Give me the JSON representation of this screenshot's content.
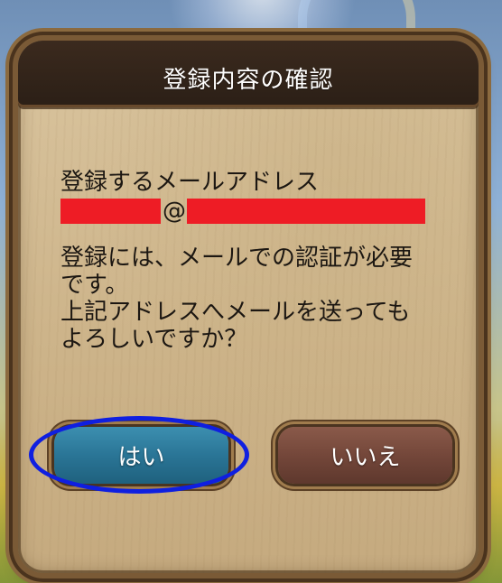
{
  "dialog": {
    "title": "登録内容の確認",
    "email_label": "登録するメールアドレス",
    "email_at": "@",
    "message_lines": [
      "登録には、メールでの認証が必要",
      "です。",
      "上記アドレスへメールを送っても",
      "よろしいですか？"
    ],
    "redaction_color": "#ee1c25"
  },
  "buttons": {
    "yes_label": "はい",
    "no_label": "いいえ",
    "yes_color": "#2a7596",
    "no_color": "#74473a"
  },
  "annotation": {
    "highlight_color": "#0f1fe0",
    "highlight_target": "yes-button"
  }
}
